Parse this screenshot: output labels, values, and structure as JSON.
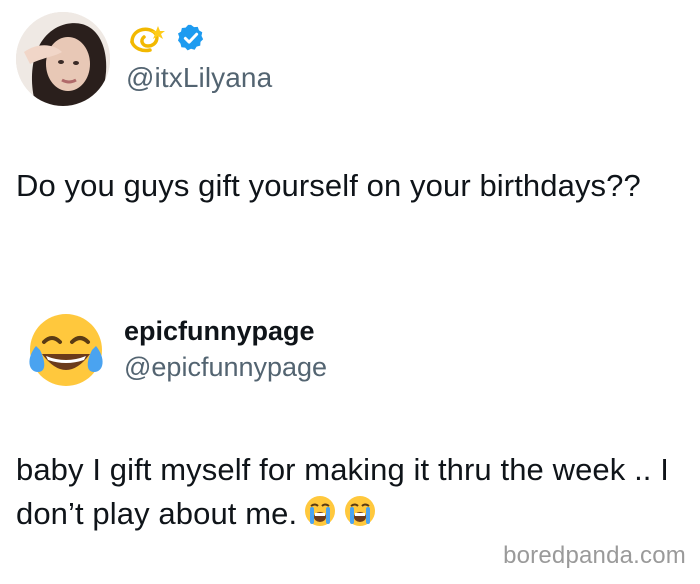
{
  "tweet1": {
    "avatar": "profile-photo",
    "header_emojis": [
      "dizzy-emoji",
      "verified-badge-icon"
    ],
    "handle": "@itxLilyana",
    "text": "Do you guys gift yourself on your birthdays??"
  },
  "tweet2": {
    "avatar": "tears-of-joy-emoji",
    "display_name": "epicfunnypage",
    "handle": "@epicfunnypage",
    "text": "baby I gift myself for making it thru the week .. I don’t play about me.",
    "trailing_emojis": [
      "loudly-crying-face-emoji",
      "loudly-crying-face-emoji"
    ]
  },
  "watermark": "boredpanda.com",
  "colors": {
    "text": "#0f1419",
    "secondary": "#536471",
    "verified": "#1d9bf0",
    "watermark": "#9a9a9a"
  }
}
